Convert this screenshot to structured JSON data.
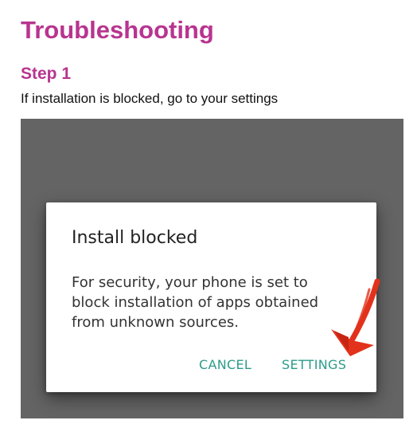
{
  "page": {
    "title": "Troubleshooting",
    "step_heading": "Step 1",
    "step_text": "If installation is blocked, go to your settings"
  },
  "dialog": {
    "title": "Install blocked",
    "message": "For security, your phone is set to block installation of apps obtained from unknown sources.",
    "cancel_label": "CANCEL",
    "settings_label": "SETTINGS"
  },
  "colors": {
    "heading": "#b8348f",
    "dialog_button": "#2c9b8a",
    "overlay": "#646464",
    "arrow": "#e2321c"
  },
  "icons": {
    "pointer": "red-arrow-icon"
  }
}
